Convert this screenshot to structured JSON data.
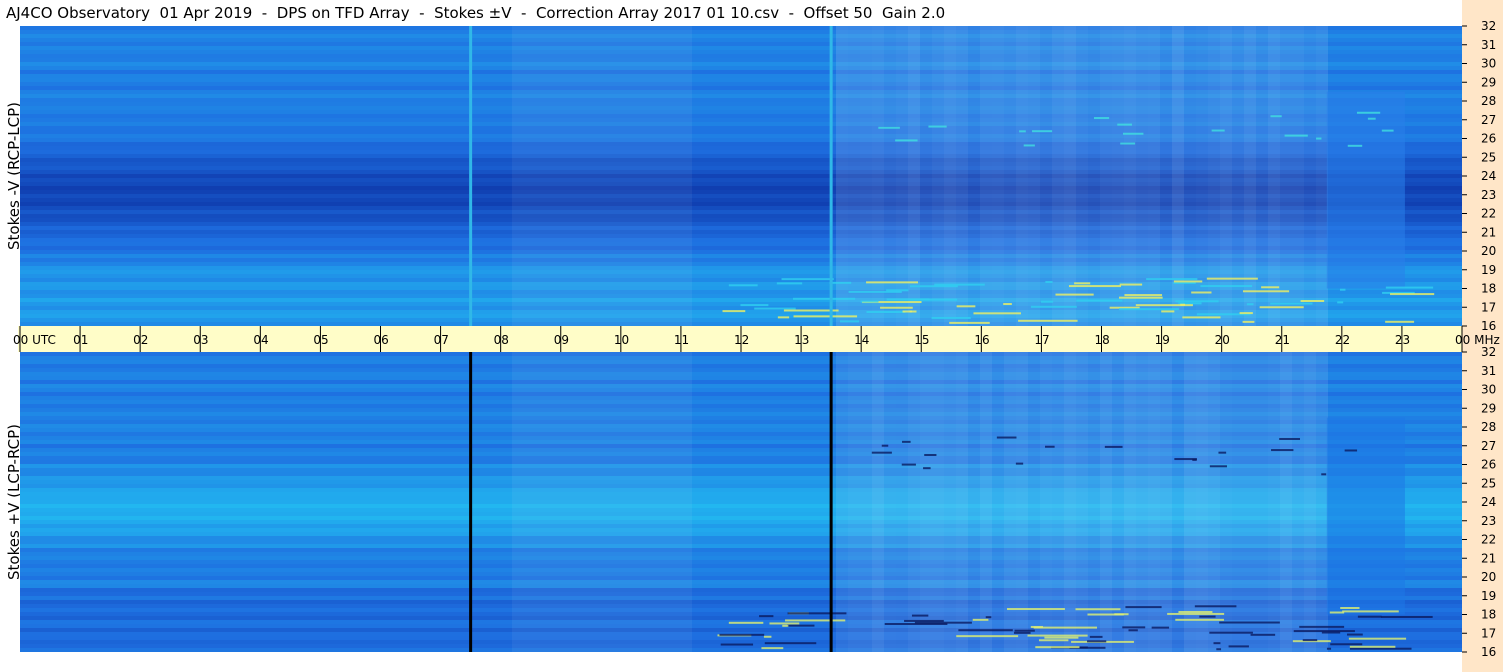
{
  "title": "AJ4CO Observatory  01 Apr 2019  -  DPS on TFD Array  -  Stokes ±V  -  Correction Array 2017 01 10.csv  -  Offset 50  Gain 2.0",
  "chart_data": [
    {
      "type": "heatmap",
      "name": "Stokes -V (RCP-LCP)",
      "ylabel": "Stokes -V (RCP-LCP)",
      "x_unit": "UTC",
      "y_unit": "MHz",
      "xlim": [
        0,
        24
      ],
      "ylim": [
        16,
        32
      ],
      "x_ticks": [
        "00 UTC",
        "01",
        "02",
        "03",
        "04",
        "05",
        "06",
        "07",
        "08",
        "09",
        "10",
        "11",
        "12",
        "13",
        "14",
        "15",
        "16",
        "17",
        "18",
        "19",
        "20",
        "21",
        "22",
        "23",
        "00 MHz"
      ],
      "y_ticks": [
        "16",
        "17",
        "18",
        "19",
        "20",
        "21",
        "22",
        "23",
        "24",
        "25",
        "26",
        "27",
        "28",
        "29",
        "30",
        "31",
        "32"
      ],
      "vertical_lines_utc": [
        7.5,
        13.5
      ],
      "vertical_line_color": "#30b8e8"
    },
    {
      "type": "heatmap",
      "name": "Stokes +V (LCP-RCP)",
      "ylabel": "Stokes +V (LCP-RCP)",
      "x_unit": "UTC",
      "y_unit": "MHz",
      "xlim": [
        0,
        24
      ],
      "ylim": [
        16,
        32
      ],
      "y_ticks": [
        "16",
        "17",
        "18",
        "19",
        "20",
        "21",
        "22",
        "23",
        "24",
        "25",
        "26",
        "27",
        "28",
        "29",
        "30",
        "31",
        "32"
      ],
      "vertical_lines_utc": [
        7.5,
        13.5
      ],
      "vertical_line_color": "#000000"
    }
  ],
  "colors": {
    "utc_bar": "#fffdc8",
    "right_strip": "#ffe6c8",
    "low": "#0a2a9c",
    "mid": "#1e6ee0",
    "high": "#22b8f0",
    "peak": "#c8f040"
  }
}
